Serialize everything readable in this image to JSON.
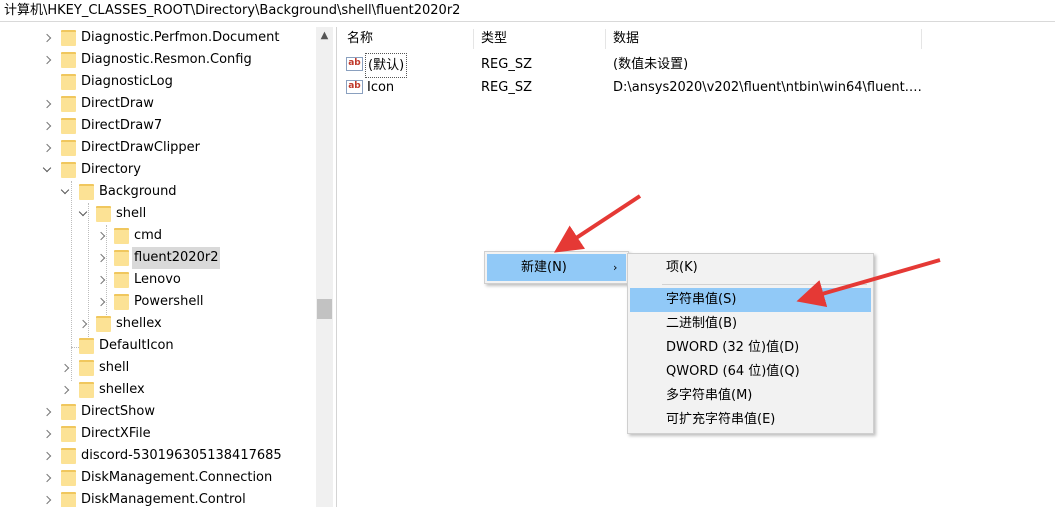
{
  "address_bar": {
    "path": "计算机\\HKEY_CLASSES_ROOT\\Directory\\Background\\shell\\fluent2020r2"
  },
  "tree": {
    "items": [
      {
        "label": "Diagnostic.Perfmon.Document"
      },
      {
        "label": "Diagnostic.Resmon.Config"
      },
      {
        "label": "DiagnosticLog"
      },
      {
        "label": "DirectDraw"
      },
      {
        "label": "DirectDraw7"
      },
      {
        "label": "DirectDrawClipper"
      },
      {
        "label": "Directory"
      },
      {
        "label": "Background"
      },
      {
        "label": "shell"
      },
      {
        "label": "cmd"
      },
      {
        "label": "fluent2020r2"
      },
      {
        "label": "Lenovo"
      },
      {
        "label": "Powershell"
      },
      {
        "label": "shellex"
      },
      {
        "label": "DefaultIcon"
      },
      {
        "label": "shell"
      },
      {
        "label": "shellex"
      },
      {
        "label": "DirectShow"
      },
      {
        "label": "DirectXFile"
      },
      {
        "label": "discord-530196305138417685"
      },
      {
        "label": "DiskManagement.Connection"
      },
      {
        "label": "DiskManagement.Control"
      }
    ]
  },
  "list": {
    "headers": {
      "name": "名称",
      "type": "类型",
      "data": "数据"
    },
    "rows": [
      {
        "name": "(默认)",
        "type": "REG_SZ",
        "data": "(数值未设置)",
        "icon": "string-value-icon"
      },
      {
        "name": "Icon",
        "type": "REG_SZ",
        "data": "D:\\ansys2020\\v202\\fluent\\ntbin\\win64\\fluent.e...",
        "icon": "string-value-icon"
      }
    ]
  },
  "context_menu": {
    "new_label": "新建(N)",
    "arrow": "›"
  },
  "submenu": {
    "items": [
      {
        "label": "项(K)"
      },
      {
        "label": "字符串值(S)"
      },
      {
        "label": "二进制值(B)"
      },
      {
        "label": "DWORD (32 位)值(D)"
      },
      {
        "label": "QWORD (64 位)值(Q)"
      },
      {
        "label": "多字符串值(M)"
      },
      {
        "label": "可扩充字符串值(E)"
      }
    ]
  },
  "colors": {
    "menu_highlight": "#91c9f7",
    "annotation_arrow": "#e53935",
    "folder": "#fce295"
  }
}
